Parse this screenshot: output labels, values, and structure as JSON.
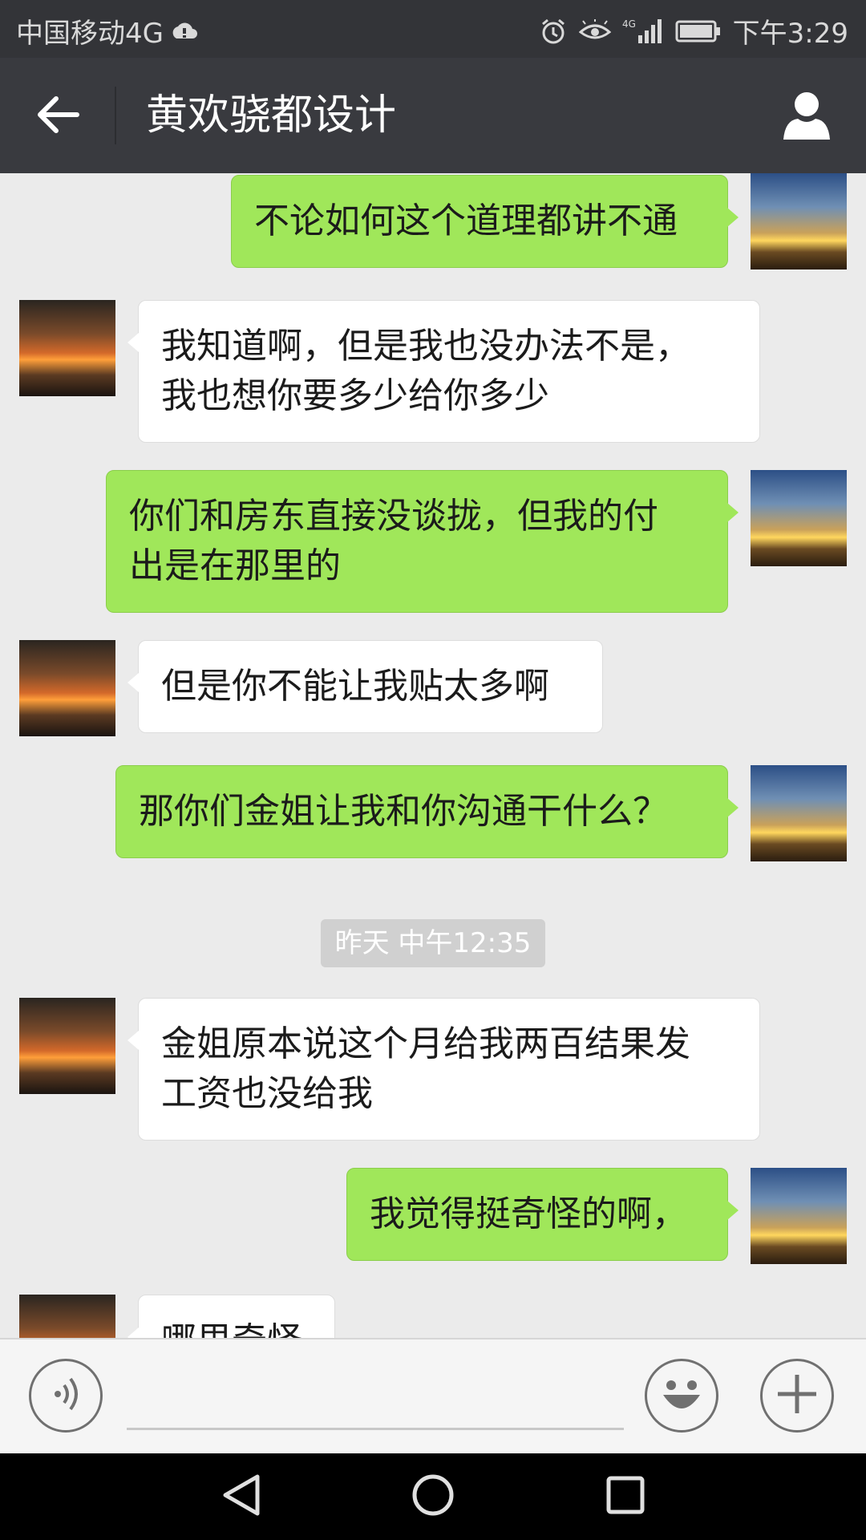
{
  "status_bar": {
    "carrier": "中国移动4G",
    "time": "下午3:29"
  },
  "header": {
    "title": "黄欢骁都设计"
  },
  "messages": [
    {
      "sender": "me",
      "text": "不论如何这个道理都讲不通"
    },
    {
      "sender": "friend",
      "text": "我知道啊，但是我也没办法不是，\n我也想你要多少给你多少"
    },
    {
      "sender": "me",
      "text": "你们和房东直接没谈拢，但我的付\n出是在那里的"
    },
    {
      "sender": "friend",
      "text": "但是你不能让我贴太多啊"
    },
    {
      "sender": "me",
      "text": "那你们金姐让我和你沟通干什么？"
    },
    {
      "sender": "friend",
      "text": "金姐原本说这个月给我两百结果发\n工资也没给我"
    },
    {
      "sender": "me",
      "text": "我觉得挺奇怪的啊，"
    },
    {
      "sender": "friend",
      "text": "哪里奇怪"
    }
  ],
  "timestamp": "昨天 中午12:35",
  "colors": {
    "my_bubble": "#a0e75a",
    "friend_bubble": "#ffffff",
    "header_bg": "#393a3f",
    "status_bg": "#333438",
    "chat_bg": "#ebebeb"
  },
  "icons": {
    "back": "arrow-left-icon",
    "profile": "person-icon",
    "voice": "voice-icon",
    "emoji": "smiley-icon",
    "more": "plus-icon",
    "nav_back": "triangle-back-icon",
    "nav_home": "circle-home-icon",
    "nav_recent": "square-recent-icon"
  }
}
